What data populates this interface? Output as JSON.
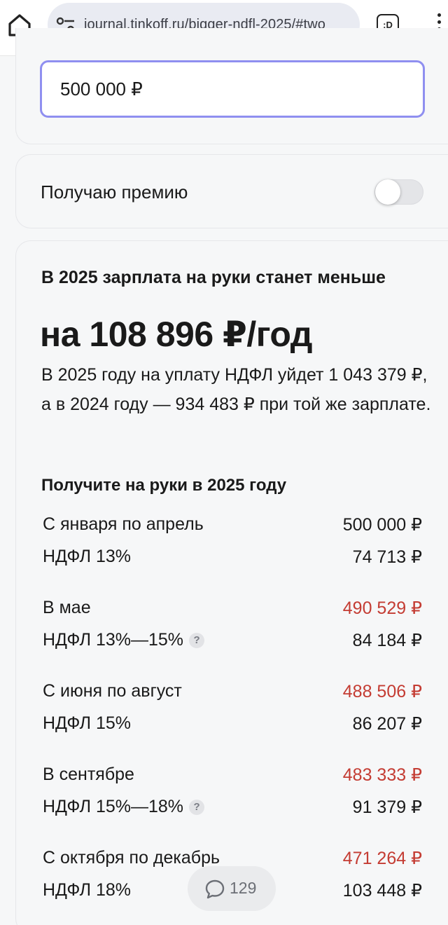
{
  "browser": {
    "url": "journal.tinkoff.ru/bigger-ndfl-2025/#two",
    "tabs_label": ":D",
    "icons": [
      "home-icon",
      "site-settings-icon",
      "tabs-icon",
      "more-vert-icon"
    ]
  },
  "salary_input": {
    "value": "500 000 ₽"
  },
  "bonus": {
    "label": "Получаю премию",
    "enabled": false
  },
  "result": {
    "headline": "В 2025 зарплата на руки станет меньше",
    "amount": "на 108 896 ₽/год",
    "description": "В 2025 году на уплату НДФЛ уйдет 1 043 379 ₽, а в 2024 году — 934 483 ₽ при той же зарплате.",
    "subheading": "Получите на руки в 2025 году",
    "periods": [
      {
        "label": "С января по апрель",
        "amount": "500 000 ₽",
        "tax_label": "НДФЛ 13%",
        "tax": "74 713 ₽",
        "help": false
      },
      {
        "label": "В мае",
        "amount": "490 529 ₽",
        "tax_label": "НДФЛ 13%—15%",
        "tax": "84 184 ₽",
        "help": true
      },
      {
        "label": "С июня по август",
        "amount": "488 506 ₽",
        "tax_label": "НДФЛ 15%",
        "tax": "86 207 ₽",
        "help": false
      },
      {
        "label": "В сентябре",
        "amount": "483 333 ₽",
        "tax_label": "НДФЛ 15%—18%",
        "tax": "91 379 ₽",
        "help": true
      },
      {
        "label": "С октября по декабрь",
        "amount": "471 264 ₽",
        "tax_label": "НДФЛ 18%",
        "tax": "103 448 ₽",
        "help": false
      }
    ],
    "help_glyph": "?"
  },
  "comments": {
    "count": "129"
  },
  "colors": {
    "accent_border": "#8f8ff0",
    "decrease_red": "#c43c33",
    "background": "#f6f7f8"
  }
}
